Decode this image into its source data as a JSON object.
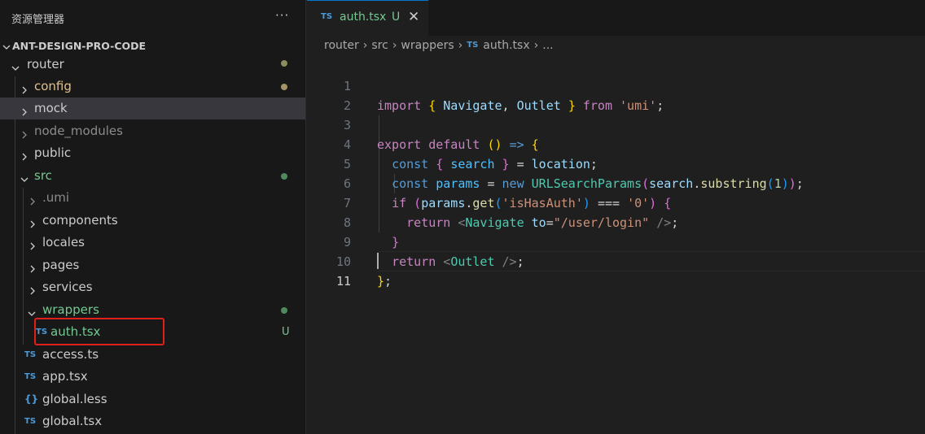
{
  "sidebar": {
    "title": "资源管理器",
    "more": "···",
    "project": "ANT-DESIGN-PRO-CODE",
    "items": [
      {
        "label": "router",
        "color": "#cccccc"
      },
      {
        "label": "config",
        "color": "#e2c08d"
      },
      {
        "label": "mock",
        "color": "#cccccc"
      },
      {
        "label": "node_modules",
        "color": "#8c8c8c"
      },
      {
        "label": "public",
        "color": "#cccccc"
      },
      {
        "label": "src",
        "color": "#73c991"
      },
      {
        "label": ".umi",
        "color": "#8c8c8c"
      },
      {
        "label": "components",
        "color": "#cccccc"
      },
      {
        "label": "locales",
        "color": "#cccccc"
      },
      {
        "label": "pages",
        "color": "#cccccc"
      },
      {
        "label": "services",
        "color": "#cccccc"
      },
      {
        "label": "wrappers",
        "color": "#73c991"
      },
      {
        "label": "auth.tsx",
        "color": "#73c991",
        "badge": "TS",
        "status": "U"
      },
      {
        "label": "access.ts",
        "color": "#cccccc",
        "badge": "TS"
      },
      {
        "label": "app.tsx",
        "color": "#cccccc",
        "badge": "TS"
      },
      {
        "label": "global.less",
        "color": "#cccccc",
        "badge": "{}"
      },
      {
        "label": "global.tsx",
        "color": "#cccccc",
        "badge": "TS"
      }
    ]
  },
  "tab": {
    "badge": "TS",
    "name": "auth.tsx",
    "status": "U",
    "close": "✕"
  },
  "breadcrumb": {
    "parts": [
      "router",
      "src",
      "wrappers"
    ],
    "file_badge": "TS",
    "file": "auth.tsx",
    "tail": "..."
  },
  "editor": {
    "line_numbers": [
      "1",
      "2",
      "3",
      "4",
      "5",
      "6",
      "7",
      "8",
      "9",
      "10",
      "11"
    ],
    "current_line": "11"
  },
  "colors": {
    "accent": "#0078d4",
    "modified": "#e2c08d",
    "untracked": "#73c991",
    "highlight": "#e0211b"
  }
}
